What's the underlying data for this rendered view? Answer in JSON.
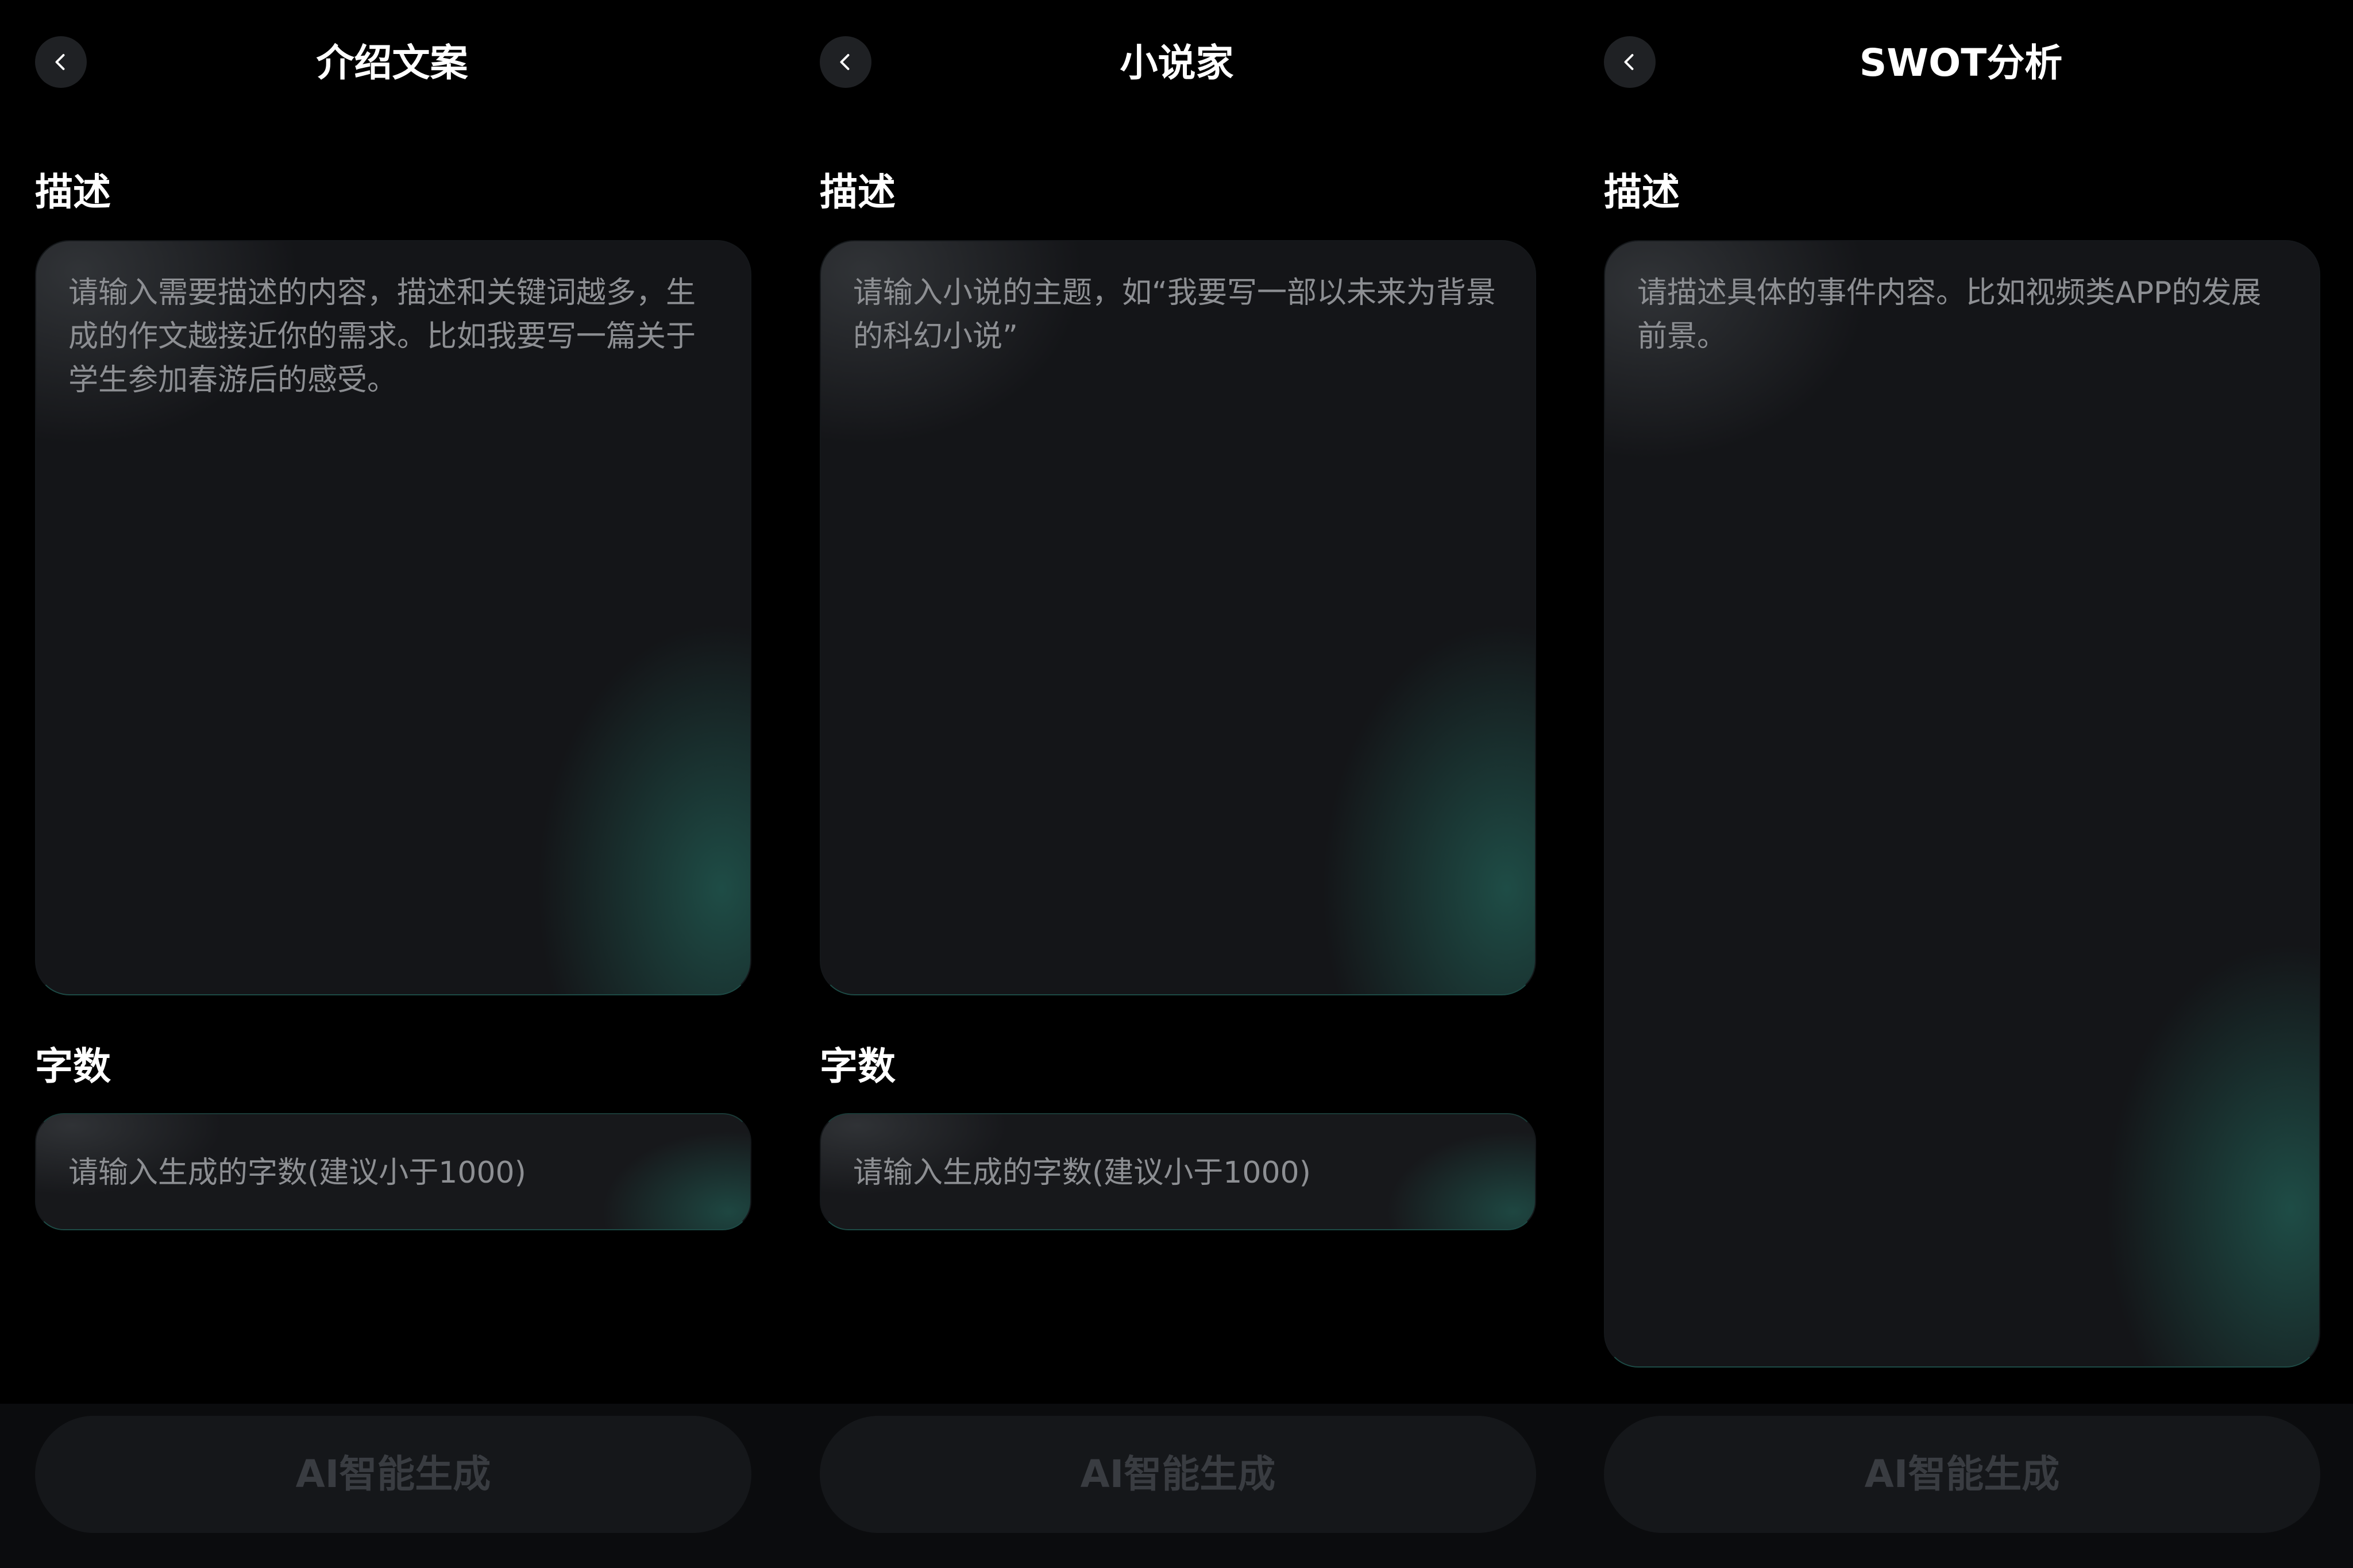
{
  "colors": {
    "background": "#000000",
    "card": "#141518",
    "accent_glow": "#20564e",
    "placeholder": "#8d8f93",
    "button_disabled_text": "#393c41"
  },
  "icons": {
    "back": "chevron-left-icon"
  },
  "screens": [
    {
      "title": "介绍文案",
      "description_label": "描述",
      "description_placeholder": "请输入需要描述的内容，描述和关键词越多，生成的作文越接近你的需求。比如我要写一篇关于学生参加春游后的感受。",
      "description_value": "",
      "word_count_label": "字数",
      "word_count_placeholder": "请输入生成的字数(建议小于1000)",
      "word_count_value": "",
      "generate_label": "AI智能生成"
    },
    {
      "title": "小说家",
      "description_label": "描述",
      "description_placeholder": "请输入小说的主题，如“我要写一部以未来为背景的科幻小说”",
      "description_value": "",
      "word_count_label": "字数",
      "word_count_placeholder": "请输入生成的字数(建议小于1000)",
      "word_count_value": "",
      "generate_label": "AI智能生成"
    },
    {
      "title": "SWOT分析",
      "description_label": "描述",
      "description_placeholder": "请描述具体的事件内容。比如视频类APP的发展前景。",
      "description_value": "",
      "generate_label": "AI智能生成"
    }
  ]
}
